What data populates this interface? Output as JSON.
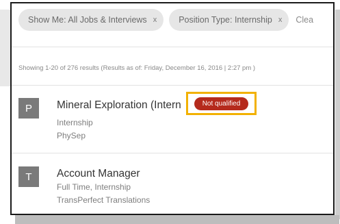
{
  "filters": {
    "chips": [
      {
        "label": "Show Me: All Jobs & Interviews",
        "remove": "x"
      },
      {
        "label": "Position Type: Internship",
        "remove": "x"
      }
    ],
    "clear_label": "Clea"
  },
  "results": {
    "info": "Showing 1-20 of 276 results  (Results as of: Friday, December 16, 2016 | 2:27 pm )"
  },
  "jobs": [
    {
      "avatar": "P",
      "title": "Mineral Exploration (Intern",
      "type": "Internship",
      "company": "PhySep",
      "badge": "Not qualified"
    },
    {
      "avatar": "T",
      "title": "Account Manager",
      "type": "Full Time, Internship",
      "company": "TransPerfect Translations"
    }
  ],
  "colors": {
    "badge": "#b52a1c",
    "highlight": "#f2b100",
    "avatar": "#7a7a7a"
  }
}
